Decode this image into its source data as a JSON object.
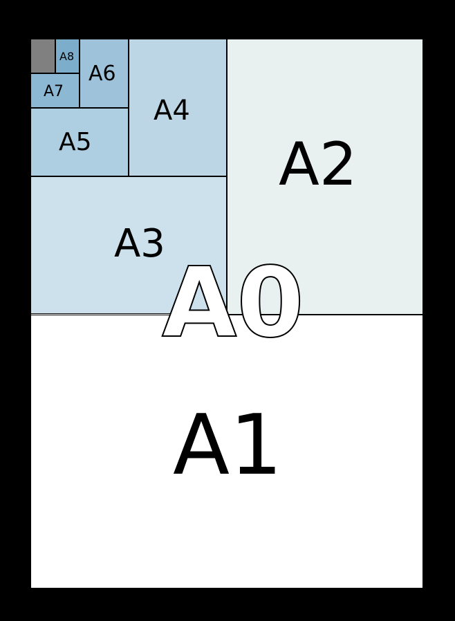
{
  "description": "ISO 216 A-series paper size diagram showing nested halving from A0 through A8",
  "labels": {
    "A0": "A0",
    "A1": "A1",
    "A2": "A2",
    "A3": "A3",
    "A4": "A4",
    "A5": "A5",
    "A6": "A6",
    "A7": "A7",
    "A8": "A8"
  },
  "colors": {
    "background": "#000000",
    "A0": "#ffffff",
    "A1": "#ffffff",
    "A2": "#e8f0f0",
    "A3": "#cde1ec",
    "A4": "#bdd6e5",
    "A5": "#aecee1",
    "A6": "#9dc2da",
    "A7": "#8db8d3",
    "A8": "#7caecc",
    "unlabeled": "#808080"
  },
  "chart_data": {
    "type": "area",
    "title": "ISO A paper size nesting",
    "series": [
      {
        "name": "A0",
        "width_rel": 1.0,
        "height_rel": 1.0
      },
      {
        "name": "A1",
        "width_rel": 1.0,
        "height_rel": 0.5
      },
      {
        "name": "A2",
        "width_rel": 0.5,
        "height_rel": 0.5
      },
      {
        "name": "A3",
        "width_rel": 0.5,
        "height_rel": 0.25
      },
      {
        "name": "A4",
        "width_rel": 0.25,
        "height_rel": 0.25
      },
      {
        "name": "A5",
        "width_rel": 0.25,
        "height_rel": 0.125
      },
      {
        "name": "A6",
        "width_rel": 0.125,
        "height_rel": 0.125
      },
      {
        "name": "A7",
        "width_rel": 0.125,
        "height_rel": 0.0625
      },
      {
        "name": "A8",
        "width_rel": 0.0625,
        "height_rel": 0.0625
      }
    ]
  }
}
